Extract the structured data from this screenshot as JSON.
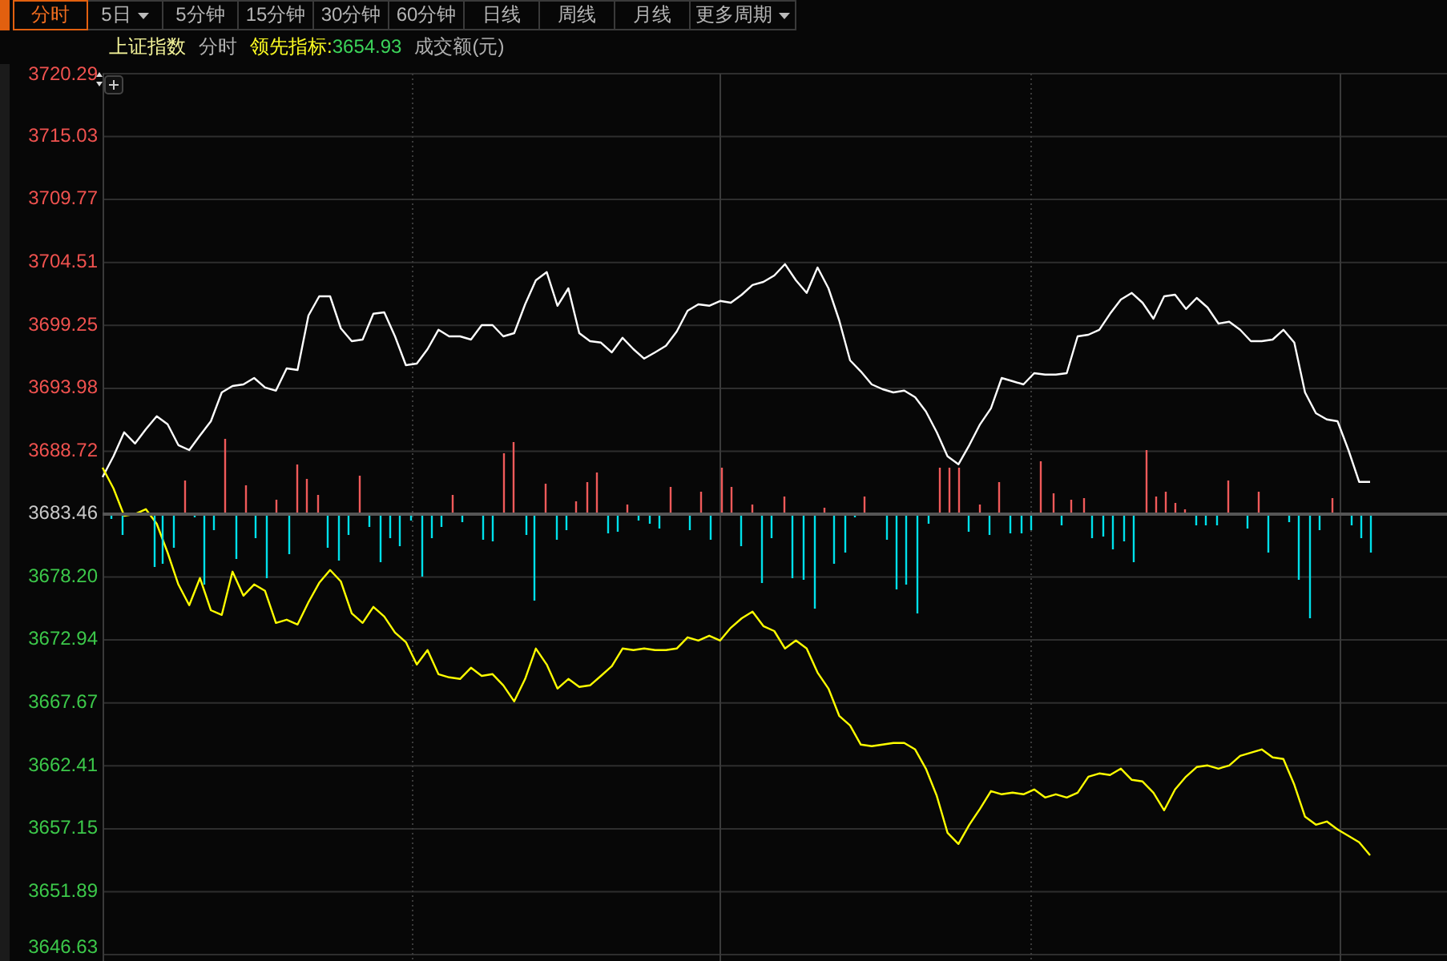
{
  "tabs": [
    {
      "label": "分时",
      "dropdown": false,
      "selected": true
    },
    {
      "label": "5日",
      "dropdown": true,
      "selected": false
    },
    {
      "label": "5分钟",
      "dropdown": false,
      "selected": false
    },
    {
      "label": "15分钟",
      "dropdown": false,
      "selected": false
    },
    {
      "label": "30分钟",
      "dropdown": false,
      "selected": false
    },
    {
      "label": "60分钟",
      "dropdown": false,
      "selected": false
    },
    {
      "label": "日线",
      "dropdown": false,
      "selected": false
    },
    {
      "label": "周线",
      "dropdown": false,
      "selected": false
    },
    {
      "label": "月线",
      "dropdown": false,
      "selected": false
    },
    {
      "label": "更多周期",
      "dropdown": true,
      "selected": false
    }
  ],
  "legend": [
    {
      "kind": "index_name"
    },
    {
      "kind": "mode",
      "text": "分时"
    },
    {
      "kind": "indicator",
      "separator": ":",
      "value": "3654.93"
    },
    {
      "kind": "amount",
      "text": "成交额(元)"
    }
  ],
  "chart": {
    "chart_data": {
      "type": "line",
      "categories": [
        null,
        null,
        null,
        null,
        null,
        null,
        null,
        null,
        null,
        null,
        null,
        null,
        null,
        null,
        null,
        null,
        null,
        null,
        null,
        null,
        null,
        null,
        null,
        null,
        null,
        null,
        null,
        null,
        null,
        null,
        null,
        null,
        null,
        null,
        null,
        null,
        null,
        null,
        null,
        null,
        null,
        null,
        null,
        null,
        null,
        null,
        null,
        null,
        null,
        null,
        null,
        null,
        null,
        null,
        null,
        null,
        null,
        null,
        null,
        null,
        null,
        null,
        null,
        null,
        null,
        null,
        null,
        null,
        null,
        null,
        null,
        null,
        null,
        null,
        null,
        null,
        null,
        null,
        null,
        null,
        null,
        null,
        null,
        null,
        null,
        null,
        null,
        null,
        null,
        null,
        null,
        null,
        null,
        null,
        null,
        null,
        null,
        null,
        null,
        null,
        null,
        null,
        null,
        null,
        null,
        null,
        null,
        null,
        null,
        null,
        null,
        null,
        null,
        null,
        null,
        null,
        null,
        null
      ],
      "ylim": [
        3646.63,
        3720.29
      ],
      "yticks": [
        {
          "value": 3720.29,
          "label": "3720.29"
        },
        {
          "value": 3715.03,
          "label": "3715.03"
        },
        {
          "value": 3709.77,
          "label": "3709.77"
        },
        {
          "value": 3704.51,
          "label": "3704.51"
        },
        {
          "value": 3699.25,
          "label": "3699.25"
        },
        {
          "value": 3693.98,
          "label": "3693.98"
        },
        {
          "value": 3688.72,
          "label": "3688.72"
        },
        {
          "value": 3683.46,
          "label": "3683.46"
        },
        {
          "value": 3678.2,
          "label": "3678.20"
        },
        {
          "value": 3672.94,
          "label": "3672.94"
        },
        {
          "value": 3667.67,
          "label": "3667.67"
        },
        {
          "value": 3662.41,
          "label": "3662.41"
        },
        {
          "value": 3657.15,
          "label": "3657.15"
        },
        {
          "value": 3651.89,
          "label": "3651.89"
        },
        {
          "value": 3646.63,
          "label": "3646.63"
        }
      ],
      "grid": true,
      "series": [
        {
          "name": "上证指数",
          "color": "#ffffff",
          "values": [
            3686.55,
            3688.29,
            3690.3,
            3689.36,
            3690.56,
            3691.64,
            3690.97,
            3689.23,
            3688.82,
            3690.03,
            3691.23,
            3693.64,
            3694.18,
            3694.31,
            3694.85,
            3694.05,
            3693.78,
            3695.65,
            3695.52,
            3700.07,
            3701.68,
            3701.68,
            3699.0,
            3697.93,
            3698.06,
            3700.21,
            3700.34,
            3698.33,
            3695.92,
            3696.05,
            3697.26,
            3698.87,
            3698.33,
            3698.33,
            3698.06,
            3699.27,
            3699.27,
            3698.33,
            3698.6,
            3701.01,
            3703.02,
            3703.69,
            3700.88,
            3702.35,
            3698.6,
            3697.93,
            3697.8,
            3696.99,
            3698.2,
            3697.26,
            3696.46,
            3696.99,
            3697.53,
            3698.73,
            3700.47,
            3701.01,
            3700.88,
            3701.28,
            3701.14,
            3701.81,
            3702.62,
            3702.88,
            3703.42,
            3704.36,
            3703.02,
            3701.95,
            3704.09,
            3702.35,
            3699.67,
            3696.32,
            3695.39,
            3694.31,
            3693.91,
            3693.64,
            3693.78,
            3693.24,
            3692.04,
            3690.3,
            3688.29,
            3687.62,
            3689.23,
            3690.97,
            3692.31,
            3694.85,
            3694.58,
            3694.31,
            3695.25,
            3695.12,
            3695.12,
            3695.25,
            3698.33,
            3698.46,
            3698.87,
            3700.21,
            3701.41,
            3701.95,
            3701.14,
            3699.8,
            3701.68,
            3701.81,
            3700.61,
            3701.54,
            3700.74,
            3699.4,
            3699.54,
            3698.87,
            3697.93,
            3697.93,
            3698.06,
            3698.87,
            3697.8,
            3693.64,
            3691.9,
            3691.37,
            3691.23,
            3688.82,
            3686.15,
            3686.15
          ]
        },
        {
          "name": "领先指标",
          "color": "#ffff00",
          "values": [
            3687.35,
            3685.61,
            3683.33,
            3683.47,
            3683.87,
            3682.66,
            3680.25,
            3677.58,
            3675.84,
            3678.11,
            3675.43,
            3675.03,
            3678.65,
            3676.64,
            3677.58,
            3677.04,
            3674.36,
            3674.63,
            3674.23,
            3676.1,
            3677.71,
            3678.78,
            3677.84,
            3675.17,
            3674.36,
            3675.7,
            3674.9,
            3673.56,
            3672.76,
            3670.88,
            3672.09,
            3670.08,
            3669.81,
            3669.68,
            3670.61,
            3669.94,
            3670.08,
            3669.14,
            3667.8,
            3669.68,
            3672.22,
            3670.88,
            3668.87,
            3669.68,
            3669.01,
            3669.14,
            3669.94,
            3670.75,
            3672.22,
            3672.09,
            3672.22,
            3672.09,
            3672.09,
            3672.22,
            3673.16,
            3672.89,
            3673.29,
            3672.89,
            3673.96,
            3674.76,
            3675.3,
            3674.1,
            3673.69,
            3672.22,
            3672.89,
            3672.22,
            3670.21,
            3668.87,
            3666.6,
            3665.79,
            3664.19,
            3664.05,
            3664.19,
            3664.32,
            3664.32,
            3663.78,
            3662.18,
            3659.9,
            3656.82,
            3655.88,
            3657.49,
            3658.83,
            3660.3,
            3660.04,
            3660.17,
            3660.04,
            3660.44,
            3659.77,
            3660.04,
            3659.77,
            3660.17,
            3661.51,
            3661.78,
            3661.64,
            3662.18,
            3661.24,
            3661.11,
            3660.17,
            3658.7,
            3660.44,
            3661.51,
            3662.31,
            3662.45,
            3662.18,
            3662.45,
            3663.25,
            3663.52,
            3663.78,
            3663.12,
            3662.98,
            3660.84,
            3658.16,
            3657.49,
            3657.76,
            3657.09,
            3656.55,
            3656.02,
            3654.93
          ]
        }
      ]
    }
  }
}
